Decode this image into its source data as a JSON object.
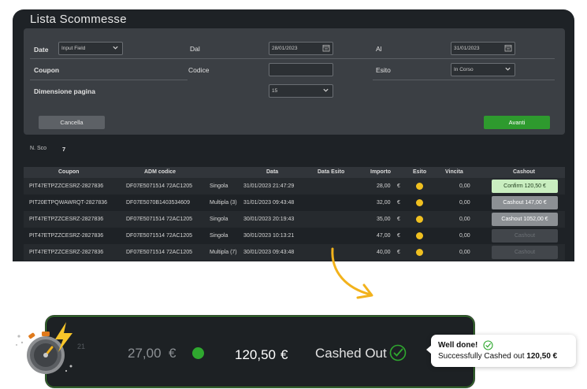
{
  "window": {
    "title": "Lista Scommesse"
  },
  "filters": {
    "date_label": "Date",
    "date_select_value": "Input Field",
    "dal_label": "Dal",
    "dal_value": "28/01/2023",
    "al_label": "Al",
    "al_value": "31/01/2023",
    "coupon_label": "Coupon",
    "codice_label": "Codice",
    "codice_value": "",
    "esito_label": "Esito",
    "esito_value": "In Corso",
    "dimensione_label": "Dimensione pagina",
    "dimensione_value": "15",
    "cancella_label": "Cancella",
    "avanti_label": "Avanti"
  },
  "summary": {
    "nsco_label": "N. Sco",
    "nsco_value": "7"
  },
  "table": {
    "headers": [
      "Coupon",
      "ADM codice",
      "Data",
      "Data Esito",
      "Importo",
      "Esito",
      "Vincita",
      "Cashout"
    ],
    "rows": [
      {
        "coupon": "PIT47ETPZZCESRZ-2827836",
        "adm": "DF07E5071514 72AC1205",
        "tipo": "Singola",
        "data": "31/01/2023 21:47:29",
        "importo": "28,00",
        "currency": "€",
        "vincita": "0,00",
        "cashout": "Confirm 120,50 €",
        "cashout_state": "confirm"
      },
      {
        "coupon": "PIT20ETPQWAWRQT-2827836",
        "adm": "DF07E5070B1403534609",
        "tipo": "Multipla (3)",
        "data": "31/01/2023 09:43:48",
        "importo": "32,00",
        "currency": "€",
        "vincita": "0,00",
        "cashout": "Cashout 147,00 €",
        "cashout_state": "active"
      },
      {
        "coupon": "PIT47ETPZZCESRZ-2827836",
        "adm": "DF07E5071514 72AC1205",
        "tipo": "Singola",
        "data": "30/01/2023 20:19:43",
        "importo": "35,00",
        "currency": "€",
        "vincita": "0,00",
        "cashout": "Cashout 1052,00 €",
        "cashout_state": "active"
      },
      {
        "coupon": "PIT47ETPZZCESRZ-2827836",
        "adm": "DF07E5071514 72AC1205",
        "tipo": "Singola",
        "data": "30/01/2023 10:13:21",
        "importo": "47,00",
        "currency": "€",
        "vincita": "0,00",
        "cashout": "Cashout",
        "cashout_state": "disabled"
      },
      {
        "coupon": "PIT47ETPZZCESRZ-2827836",
        "adm": "DF07E5071514 72AC1205",
        "tipo": "Multipla (7)",
        "data": "30/01/2023 09:43:48",
        "importo": "40,00",
        "currency": "€",
        "vincita": "0,00",
        "cashout": "Cashout",
        "cashout_state": "disabled"
      }
    ]
  },
  "zoom_card": {
    "importo": "27,00",
    "currency": "€",
    "cashout_amount": "120,50",
    "cashout_currency": "€",
    "status": "Cashed Out"
  },
  "toast": {
    "title": "Well done!",
    "message": "Successfully Cashed out",
    "amount": "120,50 €"
  },
  "colors": {
    "accent_green": "#2e9a2e",
    "status_yellow": "#f0c020",
    "confirm_green": "#c9eec0",
    "arrow_orange": "#f2b21c"
  },
  "icons": [
    "chevron-down-icon",
    "calendar-icon",
    "stopwatch-icon",
    "lightning-icon",
    "check-circle-icon",
    "arrow-icon"
  ]
}
